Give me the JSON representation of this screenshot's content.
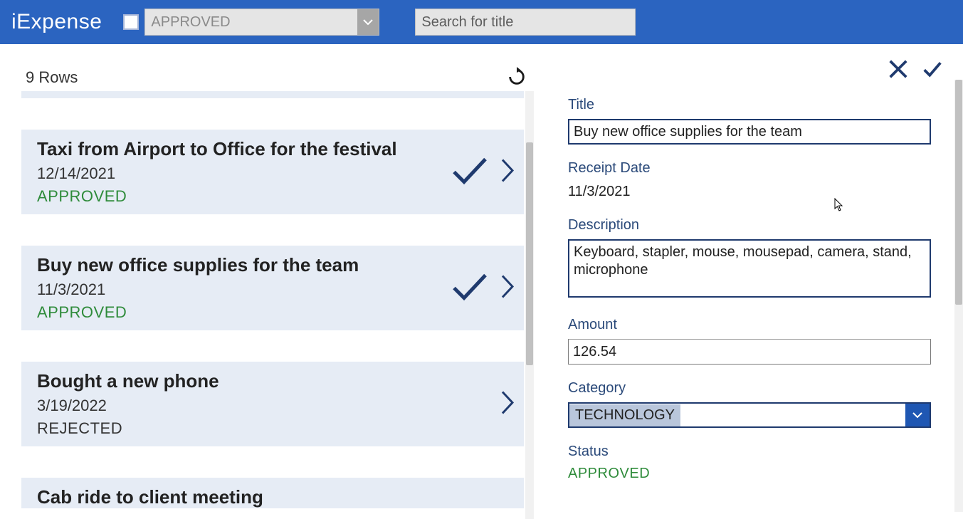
{
  "app": {
    "title": "iExpense"
  },
  "header": {
    "filter_selected": "APPROVED",
    "search_placeholder": "Search for title"
  },
  "list": {
    "rows_label": "9 Rows",
    "items": [
      {
        "title": "Taxi from Airport to Office for the festival",
        "date": "12/14/2021",
        "status": "APPROVED",
        "approved": true
      },
      {
        "title": "Buy new office supplies for the team",
        "date": "11/3/2021",
        "status": "APPROVED",
        "approved": true
      },
      {
        "title": "Bought a new phone",
        "date": "3/19/2022",
        "status": "REJECTED",
        "approved": false
      },
      {
        "title": "Cab ride to client meeting",
        "date": "",
        "status": "",
        "approved": true
      }
    ]
  },
  "detail": {
    "labels": {
      "title": "Title",
      "receipt_date": "Receipt Date",
      "description": "Description",
      "amount": "Amount",
      "category": "Category",
      "status": "Status"
    },
    "title": "Buy new office supplies for the team",
    "receipt_date": "11/3/2021",
    "description": "Keyboard, stapler, mouse, mousepad, camera, stand, microphone",
    "amount": "126.54",
    "category": "TECHNOLOGY",
    "status": "APPROVED"
  }
}
